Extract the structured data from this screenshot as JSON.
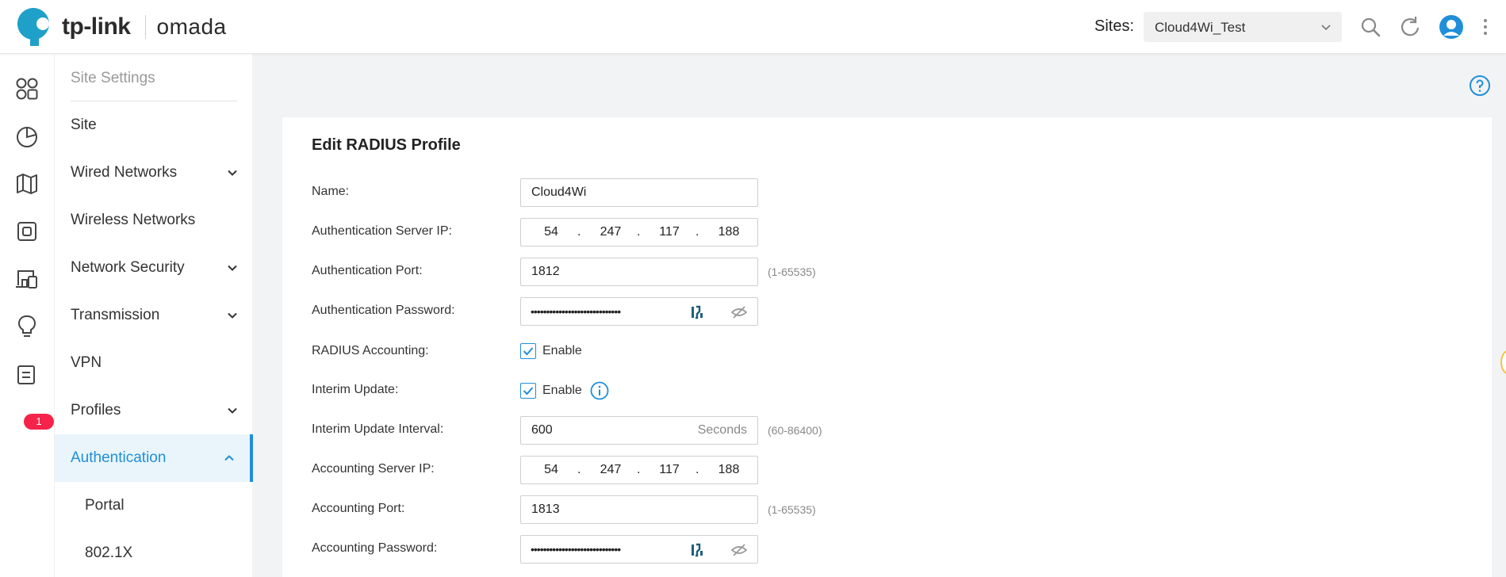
{
  "brand": {
    "logo_text": "tp-link",
    "product": "omada"
  },
  "header": {
    "sites_label": "Sites:",
    "site_selected": "Cloud4Wi_Test",
    "icons": [
      "search-icon",
      "refresh-icon",
      "user-avatar-icon",
      "more-vertical-icon"
    ]
  },
  "rail": {
    "icons": [
      "dashboard-icon",
      "statistics-icon",
      "map-icon",
      "devices-icon",
      "clients-icon",
      "insights-icon",
      "logs-icon"
    ],
    "alert_count": "1"
  },
  "sidenav": {
    "title": "Site Settings",
    "items": [
      {
        "label": "Site",
        "expandable": false
      },
      {
        "label": "Wired Networks",
        "expandable": true
      },
      {
        "label": "Wireless Networks",
        "expandable": false
      },
      {
        "label": "Network Security",
        "expandable": true
      },
      {
        "label": "Transmission",
        "expandable": true
      },
      {
        "label": "VPN",
        "expandable": false
      },
      {
        "label": "Profiles",
        "expandable": true
      },
      {
        "label": "Authentication",
        "expandable": true,
        "active": true
      },
      {
        "label": "Portal",
        "sub": true
      },
      {
        "label": "802.1X",
        "sub": true
      }
    ]
  },
  "form": {
    "title": "Edit RADIUS Profile",
    "name": {
      "label": "Name:",
      "value": "Cloud4Wi"
    },
    "auth_server_ip": {
      "label": "Authentication Server IP:",
      "octets": [
        "54",
        "247",
        "117",
        "188"
      ]
    },
    "auth_port": {
      "label": "Authentication Port:",
      "value": "1812",
      "hint": "(1-65535)"
    },
    "auth_password": {
      "label": "Authentication Password:",
      "masked": "•••••••••••••••••••••••••••••"
    },
    "radius_accounting": {
      "label": "RADIUS Accounting:",
      "checkbox_label": "Enable",
      "checked": true
    },
    "interim_update": {
      "label": "Interim Update:",
      "checkbox_label": "Enable",
      "checked": true
    },
    "interim_interval": {
      "label": "Interim Update Interval:",
      "value": "600",
      "suffix": "Seconds",
      "hint": "(60-86400)"
    },
    "acct_server_ip": {
      "label": "Accounting Server IP:",
      "octets": [
        "54",
        "247",
        "117",
        "188"
      ]
    },
    "acct_port": {
      "label": "Accounting Port:",
      "value": "1813",
      "hint": "(1-65535)"
    },
    "acct_password": {
      "label": "Accounting Password:",
      "masked": "•••••••••••••••••••••••••••••"
    }
  },
  "colors": {
    "accent": "#1f8fd9",
    "badge": "#f5234a",
    "logo": "#1fa0c9"
  }
}
